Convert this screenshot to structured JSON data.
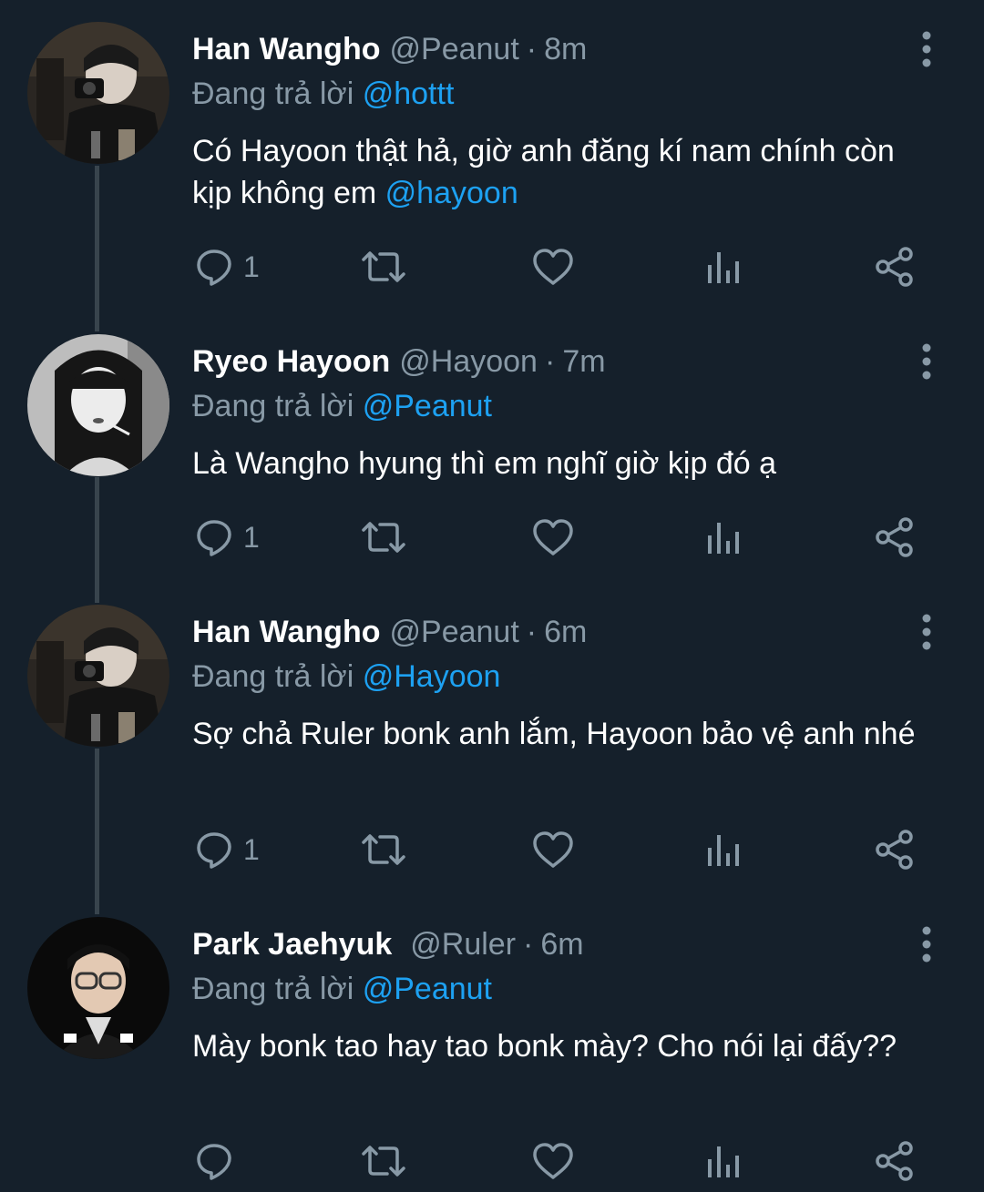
{
  "tweets": [
    {
      "display_name": "Han Wangho",
      "handle": "@Peanut",
      "separator": "·",
      "time": "8m",
      "reply_prefix": "Đang trả lời",
      "reply_to": "@hottt",
      "text": "Có Hayoon thật hả, giờ anh đăng kí nam chính còn kịp không em ",
      "text_mention": "@hayoon",
      "reply_count": "1",
      "avatar_icon": "avatar-photo"
    },
    {
      "display_name": "Ryeo Hayoon",
      "handle": "@Hayoon",
      "separator": "·",
      "time": "7m",
      "reply_prefix": "Đang trả lời",
      "reply_to": "@Peanut",
      "text": "Là Wangho hyung thì em nghĩ giờ kịp đó ạ",
      "text_mention": "",
      "reply_count": "1",
      "avatar_icon": "avatar-photo"
    },
    {
      "display_name": "Han Wangho",
      "handle": "@Peanut",
      "separator": "·",
      "time": "6m",
      "reply_prefix": "Đang trả lời",
      "reply_to": "@Hayoon",
      "text": "Sợ chả Ruler bonk anh lắm, Hayoon bảo vệ anh nhé",
      "text_mention": "",
      "reply_count": "1",
      "avatar_icon": "avatar-photo"
    },
    {
      "display_name": "Park Jaehyuk",
      "handle": "@Ruler",
      "separator": "·",
      "time": "6m",
      "reply_prefix": "Đang trả lời",
      "reply_to": "@Peanut",
      "text": "Mày bonk tao hay tao bonk mày? Cho nói lại đấy??",
      "text_mention": "",
      "reply_count": "",
      "avatar_icon": "avatar-photo"
    }
  ],
  "icons": {
    "reply": "reply-icon",
    "retweet": "retweet-icon",
    "like": "heart-icon",
    "analytics": "analytics-icon",
    "share": "share-icon",
    "more": "more-vertical-icon"
  },
  "colors": {
    "background": "#15202b",
    "text": "#ffffff",
    "secondary": "#8899a6",
    "link": "#1da1f2",
    "thread_line": "#38444d"
  }
}
